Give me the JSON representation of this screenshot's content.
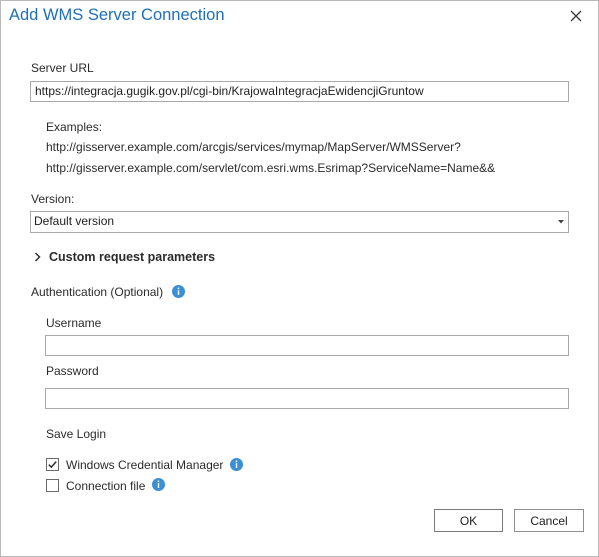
{
  "dialog": {
    "title": "Add WMS Server Connection"
  },
  "server_url": {
    "label": "Server URL",
    "value": "https://integracja.gugik.gov.pl/cgi-bin/KrajowaIntegracjaEwidencjiGruntow"
  },
  "examples": {
    "label": "Examples:",
    "lines": [
      "http://gisserver.example.com/arcgis/services/mymap/MapServer/WMSServer?",
      "http://gisserver.example.com/servlet/com.esri.wms.Esrimap?ServiceName=Name&&"
    ]
  },
  "version": {
    "label": "Version:",
    "selected": "Default version"
  },
  "custom_params": {
    "label": "Custom request parameters"
  },
  "authentication": {
    "label": "Authentication (Optional)",
    "username_label": "Username",
    "username_value": "",
    "password_label": "Password",
    "password_value": "",
    "save_login_label": "Save Login",
    "windows_credential": {
      "label": "Windows Credential Manager",
      "checked": true
    },
    "connection_file": {
      "label": "Connection file",
      "checked": false
    }
  },
  "buttons": {
    "ok": "OK",
    "cancel": "Cancel"
  },
  "colors": {
    "title": "#1f6fb5",
    "info_icon": "#3b8fd4"
  },
  "icons": [
    "close-icon",
    "chevron-down-icon",
    "chevron-right-icon",
    "info-icon",
    "checkmark-icon"
  ]
}
